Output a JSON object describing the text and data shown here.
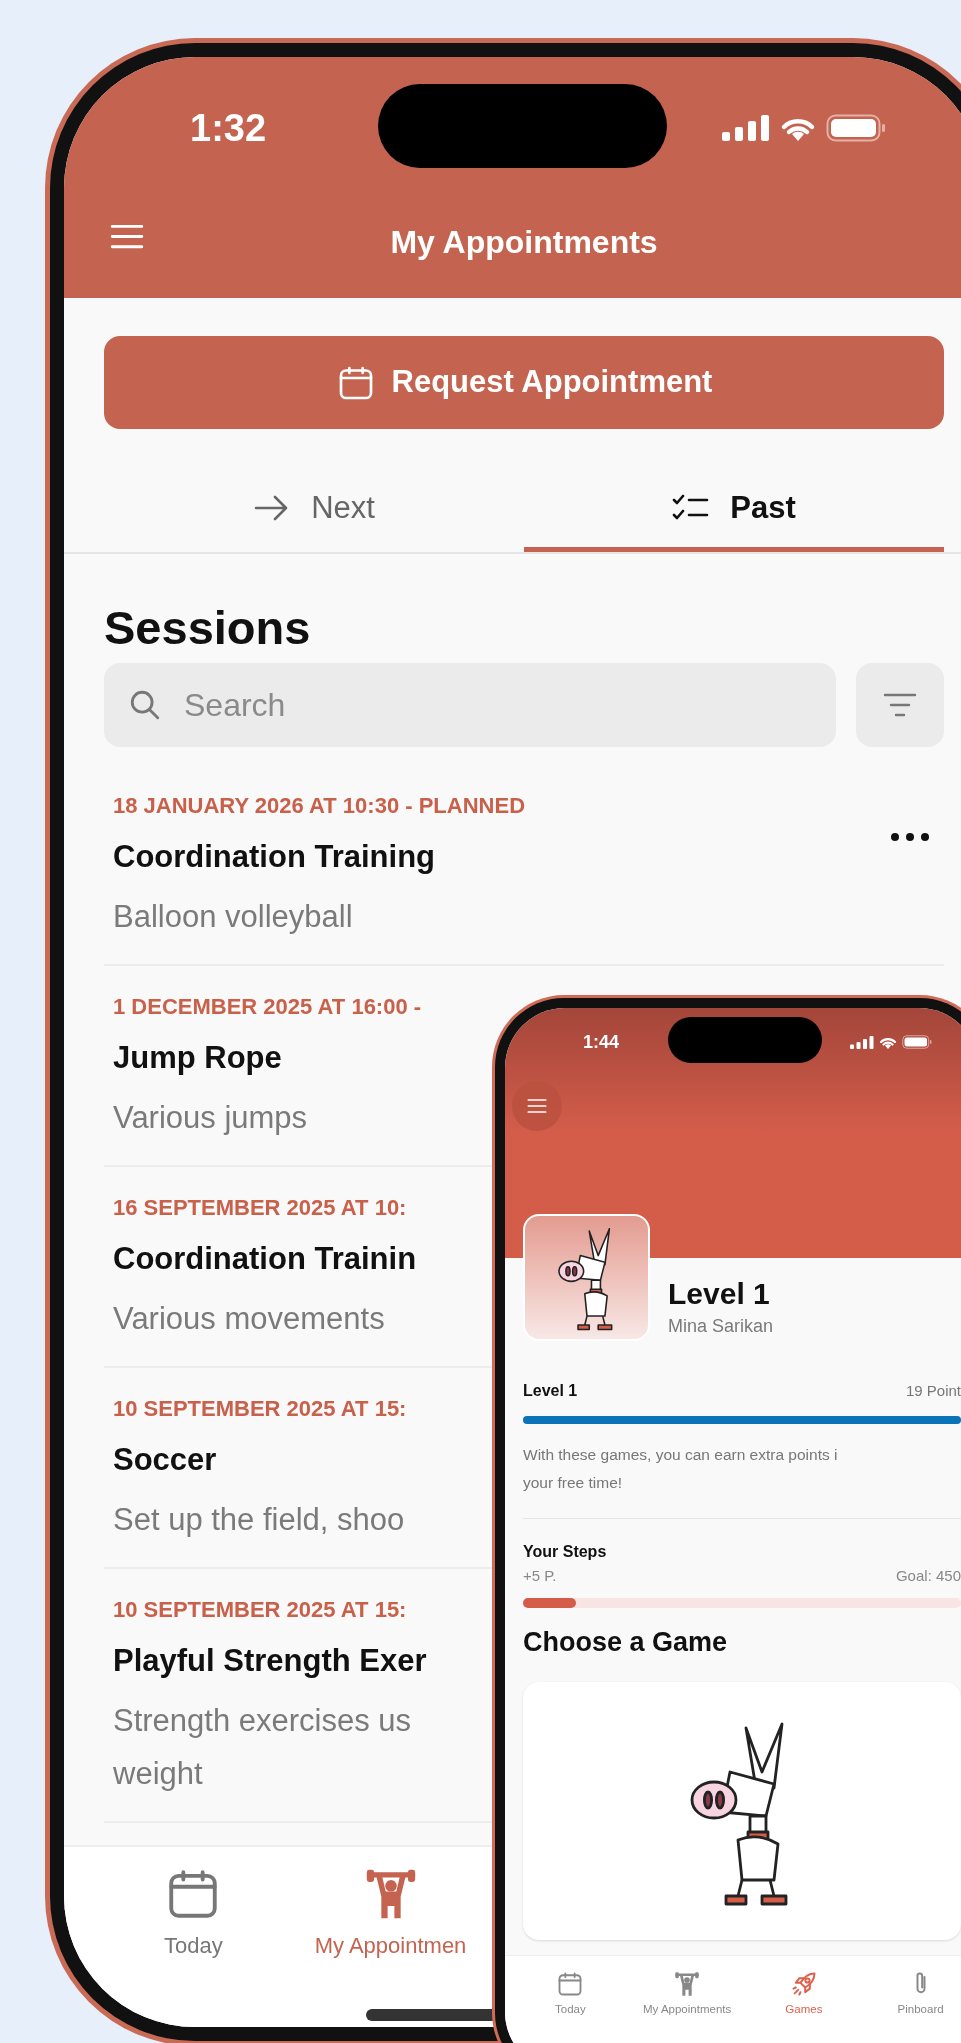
{
  "phone_back": {
    "status_time": "1:32",
    "title": "My Appointments",
    "request_button": "Request Appointment",
    "tabs": [
      {
        "label": "Next",
        "selected": false
      },
      {
        "label": "Past",
        "selected": true
      }
    ],
    "heading": "Sessions",
    "search": {
      "placeholder": "Search"
    },
    "sessions": [
      {
        "date": "18 JANUARY 2026 AT 10:30 - PLANNED",
        "title": "Coordination Training",
        "subtitle": "Balloon volleyball",
        "menu": true
      },
      {
        "date": "1 DECEMBER 2025 AT 16:00 -",
        "title": "Jump Rope",
        "subtitle": "Various jumps",
        "menu": false
      },
      {
        "date": "16 SEPTEMBER 2025 AT 10:",
        "title": "Coordination Trainin",
        "subtitle": "Various movements",
        "menu": false
      },
      {
        "date": "10 SEPTEMBER 2025 AT 15:",
        "title": "Soccer",
        "subtitle": "Set up the field, shoo",
        "menu": false
      },
      {
        "date": "10 SEPTEMBER 2025 AT 15:",
        "title": "Playful Strength Exer",
        "subtitle": "Strength exercises us\nweight",
        "menu": false
      }
    ],
    "nav": [
      {
        "label": "Today",
        "selected": false
      },
      {
        "label": "My Appointmen",
        "selected": true
      }
    ]
  },
  "phone_front": {
    "status_time": "1:44",
    "profile": {
      "level": "Level 1",
      "name": "Mina Sarikan"
    },
    "level_bar": {
      "label": "Level 1",
      "points": "19 Point",
      "level": 1
    },
    "description": "With these games, you can earn extra points i\nyour free time!",
    "steps": {
      "label": "Your Steps",
      "points": "+5 P.",
      "goal": "Goal: 450",
      "level": 0.12
    },
    "heading": "Choose a Game",
    "nav": [
      {
        "label": "Today",
        "selected": false
      },
      {
        "label": "My Appointments",
        "selected": false
      },
      {
        "label": "Games",
        "selected": true
      },
      {
        "label": "Pinboard",
        "selected": false
      }
    ]
  }
}
